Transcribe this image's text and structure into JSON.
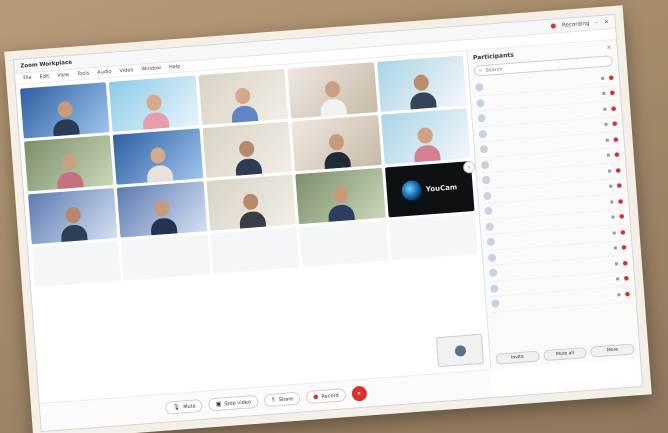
{
  "window": {
    "title": "Zoom Workplace",
    "recording_label": "Recording",
    "minimize": "–",
    "close": "✕"
  },
  "menu": [
    "File",
    "Edit",
    "View",
    "Tools",
    "Audio",
    "Video",
    "Window",
    "Help"
  ],
  "tiles": [
    {
      "label": "",
      "bg": "bg-a",
      "skin": "#c89a7b",
      "shirt": "#2b3a55"
    },
    {
      "label": "",
      "bg": "bg-b",
      "skin": "#d6a98c",
      "shirt": "#e79cab"
    },
    {
      "label": "",
      "bg": "bg-c",
      "skin": "#d3a98a",
      "shirt": "#5f86c2"
    },
    {
      "label": "",
      "bg": "bg-f",
      "skin": "#caa083",
      "shirt": "#f2f2f2"
    },
    {
      "label": "",
      "bg": "bg-h",
      "skin": "#bd8c6e",
      "shirt": "#364457"
    },
    {
      "label": "",
      "bg": "bg-d",
      "skin": "#caa083",
      "shirt": "#c66f7e"
    },
    {
      "label": "",
      "bg": "bg-a",
      "skin": "#d5aa8c",
      "shirt": "#e7e2dc"
    },
    {
      "label": "",
      "bg": "bg-c",
      "skin": "#b88a6b",
      "shirt": "#2f3d52"
    },
    {
      "label": "",
      "bg": "bg-f",
      "skin": "#c99a7a",
      "shirt": "#232b38"
    },
    {
      "label": "",
      "bg": "bg-h",
      "skin": "#d2a184",
      "shirt": "#d57f93"
    },
    {
      "label": "",
      "bg": "bg-g",
      "skin": "#b8866a",
      "shirt": "#2e3f58"
    },
    {
      "label": "",
      "bg": "bg-g",
      "skin": "#c69a7d",
      "shirt": "#24344f"
    },
    {
      "label": "",
      "bg": "bg-c",
      "skin": "#b88a6b",
      "shirt": "#3a3f47"
    },
    {
      "label": "",
      "bg": "bg-d",
      "skin": "#c99a7a",
      "shirt": "#2d3e5e"
    },
    {
      "label": "",
      "bg": "bg-f",
      "skin": "#d7ab8f",
      "shirt": "#ffffff"
    }
  ],
  "youcam": {
    "brand": "YouCam"
  },
  "bottom_names": [
    "",
    "",
    "",
    "",
    ""
  ],
  "participants": {
    "title": "Participants",
    "search_placeholder": "Search",
    "rows": [
      "",
      "",
      "",
      "",
      "",
      "",
      "",
      "",
      "",
      "",
      "",
      "",
      "",
      "",
      ""
    ],
    "invite": "Invite",
    "mute_all": "Mute all",
    "more": "More"
  },
  "toolbar": {
    "mute": "Mute",
    "video": "Stop video",
    "share": "Share",
    "record": "Record",
    "leave": "✕"
  },
  "taskbar": {
    "apps": [
      "",
      "",
      "",
      ""
    ],
    "clock": ""
  },
  "colors": {
    "accent": "#0e72ed",
    "leave": "#d6332f"
  }
}
